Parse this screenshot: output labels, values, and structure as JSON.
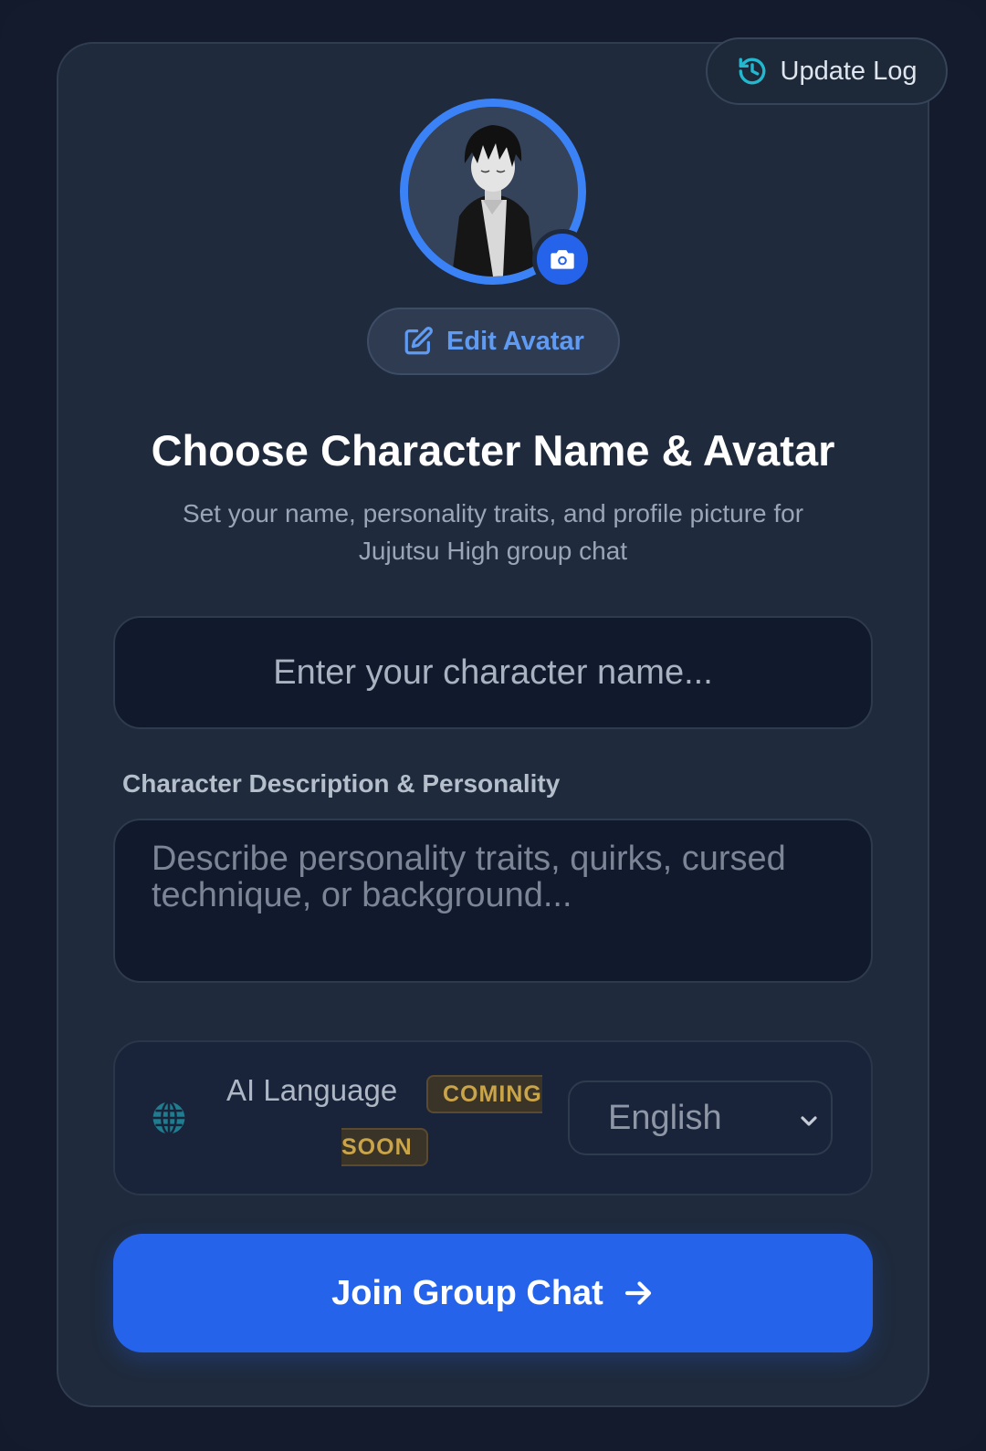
{
  "header": {
    "update_log_label": "Update Log"
  },
  "avatar": {
    "edit_label": "Edit Avatar"
  },
  "intro": {
    "title": "Choose Character Name & Avatar",
    "subtitle": "Set your name, personality traits, and profile picture for Jujutsu High group chat"
  },
  "form": {
    "name_placeholder": "Enter your character name...",
    "name_value": "",
    "description_label": "Character Description & Personality",
    "description_placeholder": "Describe personality traits, quirks, cursed technique, or background...",
    "description_value": "",
    "language": {
      "label": "AI Language",
      "badge_line1": "COMING",
      "badge_line2": "SOON",
      "selected": "English"
    }
  },
  "actions": {
    "join_label": "Join Group Chat"
  },
  "icons": {
    "update_log": "history-icon",
    "camera": "camera-icon",
    "edit": "edit-icon",
    "globe": "globe-icon",
    "dropdown": "chevron-down-icon",
    "join": "arrow-right-icon"
  },
  "colors": {
    "background": "#131b2c",
    "card": "#1f2a3c",
    "accent": "#2563eb",
    "accent_light": "#5f9bf3",
    "badge_text": "#c9a449"
  }
}
